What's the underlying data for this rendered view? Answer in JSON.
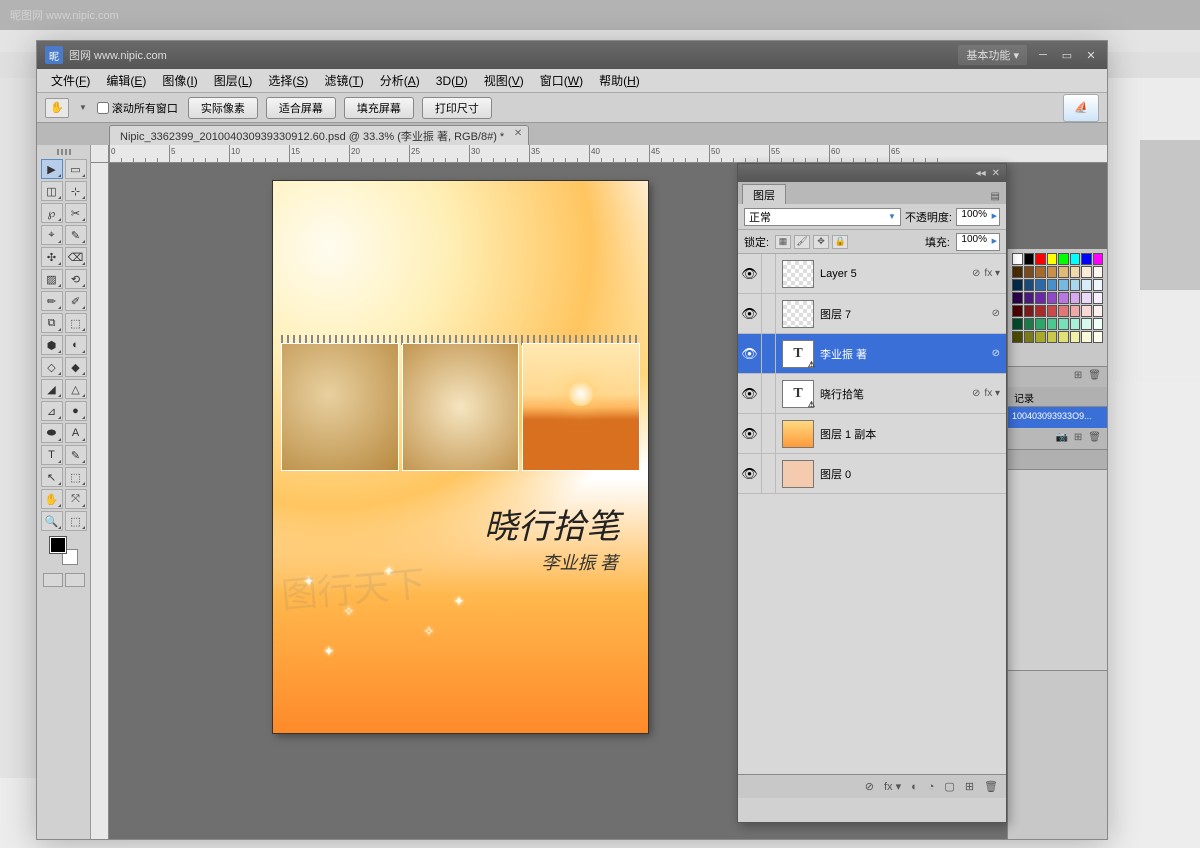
{
  "bg_title": "昵图网 www.nipic.com",
  "window": {
    "title_site": "图网 www.nipic.com",
    "workspace": "基本功能",
    "workspace_arrow": "▾"
  },
  "menu": [
    {
      "label": "文件",
      "key": "F"
    },
    {
      "label": "编辑",
      "key": "E"
    },
    {
      "label": "图像",
      "key": "I"
    },
    {
      "label": "图层",
      "key": "L"
    },
    {
      "label": "选择",
      "key": "S"
    },
    {
      "label": "滤镜",
      "key": "T"
    },
    {
      "label": "分析",
      "key": "A"
    },
    {
      "label": "3D",
      "key": "D"
    },
    {
      "label": "视图",
      "key": "V"
    },
    {
      "label": "窗口",
      "key": "W"
    },
    {
      "label": "帮助",
      "key": "H"
    }
  ],
  "options": {
    "scroll_all": "滚动所有窗口",
    "buttons": [
      "实际像素",
      "适合屏幕",
      "填充屏幕",
      "打印尺寸"
    ]
  },
  "doc_tab": {
    "name": "Nipic_3362399_201004030939330912.60.psd @ 33.3% (李业振 著, RGB/8#) *"
  },
  "cover": {
    "title": "晓行拾笔",
    "author": "李业振 著"
  },
  "layers_panel": {
    "tab": "图层",
    "blend_label": "",
    "blend_mode": "正常",
    "opacity_label": "不透明度:",
    "opacity_value": "100%",
    "lock_label": "锁定:",
    "fill_label": "填充:",
    "fill_value": "100%",
    "items": [
      {
        "name": "Layer 5",
        "type": "trans",
        "fx": true,
        "link": true
      },
      {
        "name": "图层 7",
        "type": "trans",
        "fx": false,
        "link": true
      },
      {
        "name": "李业振 著",
        "type": "text",
        "fx": false,
        "link": true,
        "selected": true
      },
      {
        "name": "晓行拾笔",
        "type": "text",
        "fx": true,
        "link": true
      },
      {
        "name": "图层 1 副本",
        "type": "img",
        "fx": false,
        "link": false
      },
      {
        "name": "图层 0",
        "type": "solid",
        "fx": false,
        "link": false
      }
    ],
    "footer_icons": [
      "⊘",
      "fx ▾",
      "◐",
      "◔",
      "▢",
      "⊞",
      "🗑"
    ]
  },
  "history": {
    "tab": "记录",
    "items": [
      "100403093933O9..."
    ]
  },
  "swatch_colors": [
    "#ffffff",
    "#000000",
    "#ff0000",
    "#ffff00",
    "#00ff00",
    "#00ffff",
    "#0000ff",
    "#ff00ff",
    "#4a2a00",
    "#7a4a1a",
    "#a86a2a",
    "#c8904a",
    "#e0b878",
    "#f0d8a8",
    "#faecd8",
    "#fff8f0",
    "#002a4a",
    "#1a4a7a",
    "#2a6aa8",
    "#4a90c8",
    "#78b8e0",
    "#a8d8f0",
    "#d8ecfa",
    "#f0f8ff",
    "#2a004a",
    "#4a1a7a",
    "#6a2aa8",
    "#904ac8",
    "#b878e0",
    "#d8a8f0",
    "#ecd8fa",
    "#f8f0ff",
    "#4a0000",
    "#7a1a1a",
    "#a82a2a",
    "#c84a4a",
    "#e07878",
    "#f0a8a8",
    "#fad8d8",
    "#fff0f0",
    "#004a2a",
    "#1a7a4a",
    "#2aa86a",
    "#4ac890",
    "#78e0b8",
    "#a8f0d8",
    "#d8faec",
    "#f0fff8",
    "#4a4a00",
    "#7a7a1a",
    "#a8a82a",
    "#c8c84a",
    "#e0e078",
    "#f0f0a8",
    "#fafad8",
    "#fffff0"
  ]
}
